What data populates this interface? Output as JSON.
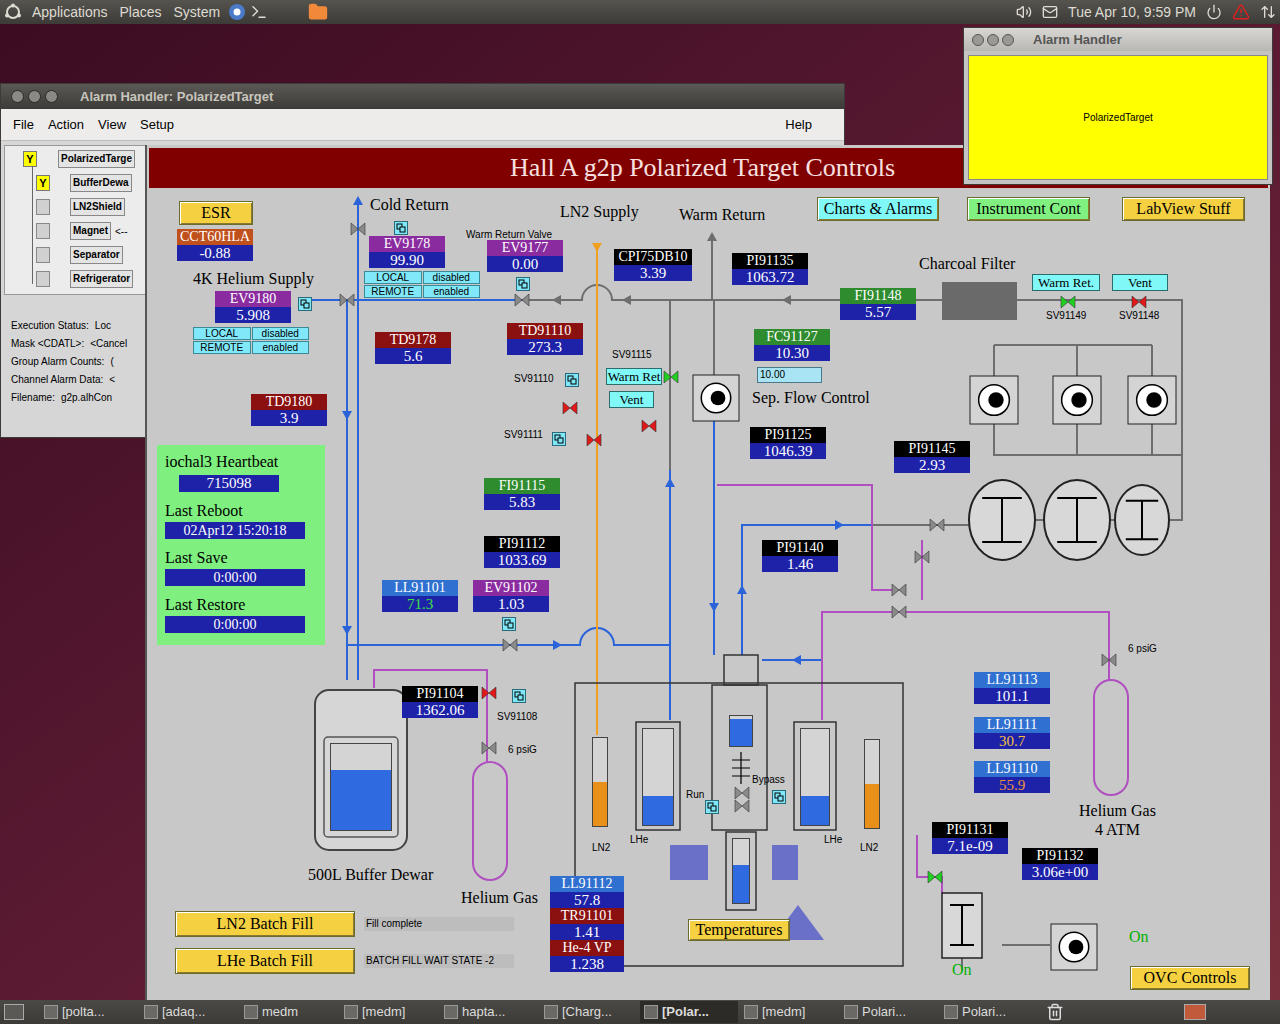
{
  "top_panel": {
    "menus": [
      "Applications",
      "Places",
      "System"
    ],
    "clock": "Tue Apr 10, 9:59 PM"
  },
  "alarm_handler_small": {
    "title": "Alarm Handler",
    "group": "PolarizedTarget"
  },
  "alarm_handler": {
    "title": "Alarm Handler: PolarizedTarget",
    "menus": [
      "File",
      "Action",
      "View",
      "Setup"
    ],
    "help_menu": "Help",
    "tree": [
      {
        "label": "PolarizedTarge",
        "flag": "Y",
        "depth": 0,
        "note": ""
      },
      {
        "label": "BufferDewa",
        "flag": "Y",
        "depth": 1,
        "note": ""
      },
      {
        "label": "LN2Shield",
        "flag": "",
        "depth": 1,
        "note": ""
      },
      {
        "label": "Magnet",
        "flag": "",
        "depth": 1,
        "note": "<--"
      },
      {
        "label": "Separator",
        "flag": "",
        "depth": 1,
        "note": ""
      },
      {
        "label": "Refrigerator",
        "flag": "",
        "depth": 1,
        "note": ""
      }
    ],
    "status": [
      {
        "label": "Execution Status:",
        "value": "Loc"
      },
      {
        "label": "Mask <CDATL>:",
        "value": "<Cancel"
      },
      {
        "label": "Group Alarm Counts:",
        "value": "("
      },
      {
        "label": "Channel Alarm Data:",
        "value": "<"
      },
      {
        "label": "Filename:",
        "value": "g2p.alhCon"
      }
    ]
  },
  "medm": {
    "title": "Hall A g2p Polarized Target Controls",
    "buttons": [
      {
        "label": "ESR",
        "kind": "large",
        "color": "#f5d142"
      },
      {
        "label": "Charts & Alarms",
        "kind": "large",
        "color": "#80f8f8"
      },
      {
        "label": "Instrument Cont",
        "kind": "large",
        "color": "#80f080"
      },
      {
        "label": "LabView Stuff",
        "kind": "large",
        "color": "#f5d142"
      },
      {
        "label": "Warm Ret.",
        "kind": "small",
        "color": "#80f8f8"
      },
      {
        "label": "Vent",
        "kind": "small",
        "color": "#80f8f8"
      },
      {
        "label": "Warm Ret",
        "kind": "small",
        "color": "#80f8f8"
      },
      {
        "label": "Vent",
        "kind": "small",
        "color": "#80f8f8"
      },
      {
        "label": "Temperatures",
        "kind": "large",
        "color": "#f5d142"
      },
      {
        "label": "OVC Controls",
        "kind": "large",
        "color": "#f5d142"
      }
    ],
    "readouts": [
      {
        "tag": "CCT60HLA",
        "value": "-0.88",
        "color": "#c0501c",
        "value_color": "#ffffff"
      },
      {
        "tag": "EV9178",
        "value": "99.90",
        "color": "#8a2ca0",
        "value_color": "#ffffff"
      },
      {
        "tag": "EV9177",
        "value": "0.00",
        "color": "#8a2ca0",
        "value_color": "#ffffff"
      },
      {
        "tag": "EV9180",
        "value": "5.908",
        "color": "#8a2ca0",
        "value_color": "#ffffff"
      },
      {
        "tag": "CPI75DB10",
        "value": "3.39",
        "color": "#000000",
        "value_color": "#ffffff"
      },
      {
        "tag": "PI91135",
        "value": "1063.72",
        "color": "#000000",
        "value_color": "#ffffff"
      },
      {
        "tag": "FI91148",
        "value": "5.57",
        "color": "#2e8b2e",
        "value_color": "#ffffff"
      },
      {
        "tag": "TD9178",
        "value": "5.6",
        "color": "#8b1010",
        "value_color": "#ffffff"
      },
      {
        "tag": "TD91110",
        "value": "273.3",
        "color": "#8b1010",
        "value_color": "#ffffff"
      },
      {
        "tag": "FC91127",
        "value": "10.30",
        "color": "#2e8b2e",
        "value_color": "#ffffff"
      },
      {
        "tag": "TD9180",
        "value": "3.9",
        "color": "#8b1010",
        "value_color": "#ffffff"
      },
      {
        "tag": "PI91125",
        "value": "1046.39",
        "color": "#000000",
        "value_color": "#ffffff"
      },
      {
        "tag": "PI91145",
        "value": "2.93",
        "color": "#000000",
        "value_color": "#ffffff"
      },
      {
        "tag": "FI91115",
        "value": "5.83",
        "color": "#2e8b2e",
        "value_color": "#ffffff"
      },
      {
        "tag": "PI91112",
        "value": "1033.69",
        "color": "#000000",
        "value_color": "#ffffff"
      },
      {
        "tag": "PI91140",
        "value": "1.46",
        "color": "#000000",
        "value_color": "#ffffff"
      },
      {
        "tag": "LL91101",
        "value": "71.3",
        "color": "#3070d0",
        "value_color": "#40e040"
      },
      {
        "tag": "EV91102",
        "value": "1.03",
        "color": "#8a2ca0",
        "value_color": "#ffffff"
      },
      {
        "tag": "PI91104",
        "value": "1362.06",
        "color": "#000000",
        "value_color": "#ffffff"
      },
      {
        "tag": "LL91113",
        "value": "101.1",
        "color": "#3070d0",
        "value_color": "#ffffff"
      },
      {
        "tag": "LL91111",
        "value": "30.7",
        "color": "#3070d0",
        "value_color": "#f0c040"
      },
      {
        "tag": "LL91110",
        "value": "55.9",
        "color": "#3070d0",
        "value_color": "#f09040"
      },
      {
        "tag": "PI91131",
        "value": "7.1e-09",
        "color": "#000000",
        "value_color": "#ffffff"
      },
      {
        "tag": "PI91132",
        "value": "3.06e+00",
        "color": "#000000",
        "value_color": "#ffffff"
      },
      {
        "tag": "LL91112",
        "value": "57.8",
        "color": "#3070d0",
        "value_color": "#ffffff"
      },
      {
        "tag": "TR91101",
        "value": "1.41",
        "color": "#8b1010",
        "value_color": "#ffffff"
      },
      {
        "tag": "He-4 VP",
        "value": "1.238",
        "color": "#8b1010",
        "value_color": "#ffffff"
      }
    ],
    "setpoint": "10.00",
    "mode_groups": [
      {
        "cells": [
          "LOCAL",
          "disabled",
          "REMOTE",
          "enabled"
        ]
      },
      {
        "cells": [
          "LOCAL",
          "disabled",
          "REMOTE",
          "enabled"
        ]
      }
    ],
    "heartbeat": {
      "title": "iochal3 Heartbeat",
      "value": "715098",
      "rows": [
        {
          "label": "Last Reboot",
          "value": "02Apr12 15:20:18"
        },
        {
          "label": "Last Save",
          "value": "0:00:00"
        },
        {
          "label": "Last Restore",
          "value": "0:00:00"
        }
      ]
    },
    "batch_fills": [
      {
        "label": "LN2 Batch Fill",
        "status": "Fill complete"
      },
      {
        "label": "LHe Batch Fill",
        "status": "BATCH FILL WAIT STATE -2"
      }
    ],
    "labels": [
      {
        "text": "Cold Return",
        "kind": "heading"
      },
      {
        "text": "LN2 Supply",
        "kind": "heading"
      },
      {
        "text": "Warm Return",
        "kind": "heading"
      },
      {
        "text": "Charcoal Filter",
        "kind": "heading"
      },
      {
        "text": "4K Helium Supply",
        "kind": "heading"
      },
      {
        "text": "Warm Return Valve",
        "kind": "small"
      },
      {
        "text": "Sep. Flow Control",
        "kind": "heading"
      },
      {
        "text": "SV91115",
        "kind": "small"
      },
      {
        "text": "SV91110",
        "kind": "small"
      },
      {
        "text": "SV91111",
        "kind": "small"
      },
      {
        "text": "SV91108",
        "kind": "small"
      },
      {
        "text": "SV91149",
        "kind": "small"
      },
      {
        "text": "SV91148",
        "kind": "small"
      },
      {
        "text": "6 psiG",
        "kind": "small"
      },
      {
        "text": "6 psiG",
        "kind": "small"
      },
      {
        "text": "500L Buffer Dewar",
        "kind": "heading"
      },
      {
        "text": "Helium Gas",
        "kind": "heading"
      },
      {
        "text": "Helium Gas",
        "kind": "heading"
      },
      {
        "text": "4 ATM",
        "kind": "heading"
      },
      {
        "text": "LN2",
        "kind": "small"
      },
      {
        "text": "LHe",
        "kind": "small"
      },
      {
        "text": "LHe",
        "kind": "small"
      },
      {
        "text": "LN2",
        "kind": "small"
      },
      {
        "text": "Run",
        "kind": "small"
      },
      {
        "text": "Bypass",
        "kind": "small"
      },
      {
        "text": "On",
        "kind": "status"
      },
      {
        "text": "On",
        "kind": "status"
      }
    ],
    "valves": [
      {
        "open": false
      },
      {
        "open": false
      },
      {
        "open": true
      },
      {
        "open": false
      },
      {
        "open": false
      },
      {
        "open": true
      },
      {
        "open": false
      },
      {
        "open": true
      }
    ],
    "tanks": [
      {
        "kind": "lhe",
        "level": 0.7
      },
      {
        "kind": "ln2",
        "level": 0.5
      },
      {
        "kind": "lhe",
        "level": 0.3
      },
      {
        "kind": "lhe",
        "level": 0.9
      },
      {
        "kind": "lhe",
        "level": 0.6
      },
      {
        "kind": "lhe",
        "level": 0.3
      },
      {
        "kind": "ln2",
        "level": 0.5
      }
    ]
  },
  "taskbar": {
    "items": [
      {
        "label": "[polta...",
        "selected": false
      },
      {
        "label": "[adaq...",
        "selected": false
      },
      {
        "label": "medm",
        "selected": false
      },
      {
        "label": "[medm]",
        "selected": false
      },
      {
        "label": "hapta...",
        "selected": false
      },
      {
        "label": "[Charg...",
        "selected": false
      },
      {
        "label": "[Polar...",
        "selected": true
      },
      {
        "label": "[medm]",
        "selected": false
      },
      {
        "label": "Polari...",
        "selected": false
      },
      {
        "label": "Polari...",
        "selected": false
      }
    ]
  }
}
